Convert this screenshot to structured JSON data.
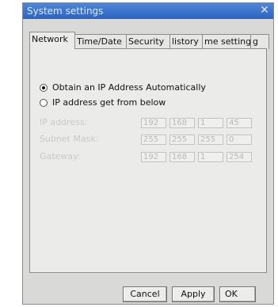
{
  "window": {
    "title": "System settings"
  },
  "tabs": [
    {
      "label": "Network"
    },
    {
      "label": "Time/Date"
    },
    {
      "label": "Security"
    },
    {
      "label": "listory"
    },
    {
      "label": "me setting"
    },
    {
      "label": "g"
    }
  ],
  "network": {
    "options": [
      {
        "label": "Obtain an IP Address Automatically",
        "selected": true
      },
      {
        "label": "IP address get from below",
        "selected": false
      }
    ],
    "fields": [
      {
        "label": "IP address:",
        "octets": [
          "192",
          "168",
          "1",
          "45"
        ]
      },
      {
        "label": "Subnet Mask:",
        "octets": [
          "255",
          "255",
          "255",
          "0"
        ]
      },
      {
        "label": "Gateway:",
        "octets": [
          "192",
          "168",
          "1",
          "254"
        ]
      }
    ]
  },
  "buttons": {
    "cancel": "Cancel",
    "apply": "Apply",
    "ok": "OK"
  }
}
